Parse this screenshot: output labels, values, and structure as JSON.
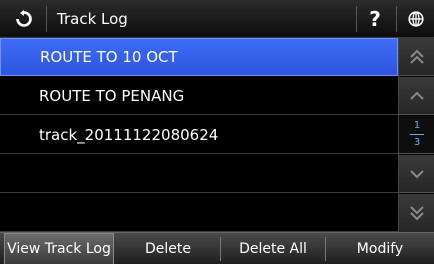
{
  "title": "Track Log",
  "icons": {
    "back": "refresh-back-icon",
    "help": "help-icon",
    "globe": "globe-icon",
    "scroll_top": "double-chevron-up-icon",
    "scroll_up": "chevron-up-icon",
    "scroll_down": "chevron-down-icon",
    "scroll_bottom": "double-chevron-down-icon"
  },
  "help_label": "?",
  "list": {
    "items": [
      {
        "label": "ROUTE TO 10 OCT",
        "selected": true
      },
      {
        "label": "ROUTE TO PENANG",
        "selected": false
      },
      {
        "label": "track_20111122080624",
        "selected": false
      },
      {
        "label": "",
        "selected": false
      },
      {
        "label": "",
        "selected": false
      }
    ]
  },
  "pager": {
    "current": "1",
    "total": "3"
  },
  "toolbar": {
    "view_label": "View Track Log",
    "delete_label": "Delete",
    "delete_all_label": "Delete All",
    "modify_label": "Modify"
  },
  "colors": {
    "selected_row": "#3a63ee",
    "pager_text": "#5fb0ff"
  }
}
